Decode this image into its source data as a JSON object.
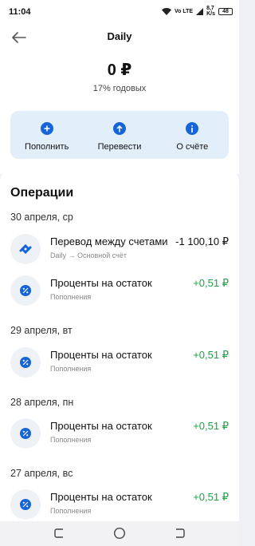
{
  "status": {
    "time": "11:04",
    "network": "Vo LTE",
    "speed_value": "8,7",
    "speed_unit": "K/s",
    "battery": "48"
  },
  "header": {
    "title": "Daily",
    "balance": "0 ₽",
    "rate": "17% годовых"
  },
  "actions": [
    {
      "label": "Пополнить",
      "icon": "plus-icon"
    },
    {
      "label": "Перевести",
      "icon": "arrow-up-icon"
    },
    {
      "label": "О счёте",
      "icon": "info-icon"
    }
  ],
  "operations": {
    "title": "Операции",
    "groups": [
      {
        "date": "30 апреля, ср",
        "items": [
          {
            "name": "Перевод между счетами",
            "sub": "Daily → Основной счёт",
            "amount": "-1 100,10 ₽",
            "type": "negative",
            "icon": "transfer-icon"
          },
          {
            "name": "Проценты на остаток",
            "sub": "Пополнения",
            "amount": "+0,51 ₽",
            "type": "positive",
            "icon": "percent-icon"
          }
        ]
      },
      {
        "date": "29 апреля, вт",
        "items": [
          {
            "name": "Проценты на остаток",
            "sub": "Пополнения",
            "amount": "+0,51 ₽",
            "type": "positive",
            "icon": "percent-icon"
          }
        ]
      },
      {
        "date": "28 апреля, пн",
        "items": [
          {
            "name": "Проценты на остаток",
            "sub": "Пополнения",
            "amount": "+0,51 ₽",
            "type": "positive",
            "icon": "percent-icon"
          }
        ]
      },
      {
        "date": "27 апреля, вс",
        "items": [
          {
            "name": "Проценты на остаток",
            "sub": "Пополнения",
            "amount": "+0,51 ₽",
            "type": "positive",
            "icon": "percent-icon"
          }
        ]
      }
    ]
  },
  "colors": {
    "accent": "#1565d8",
    "positive": "#22a045",
    "action_bg": "#e3eefb"
  }
}
